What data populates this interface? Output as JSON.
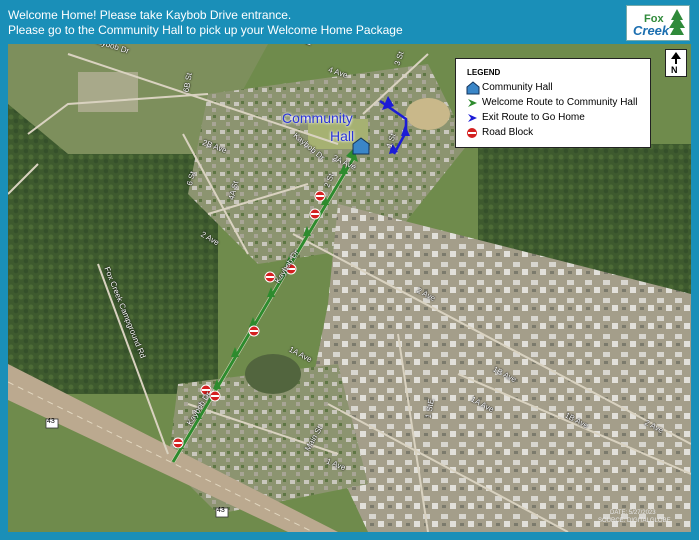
{
  "header": {
    "line1": "Welcome Home! Please take Kaybob Drive entrance.",
    "line2": "Please go to the Community Hall to pick up your Welcome Home Package"
  },
  "logo": {
    "line1": "Fox",
    "line2": "Creek"
  },
  "colors": {
    "frame": "#1a8fb8",
    "welcome_route": "#2e8b2e",
    "exit_route": "#1c1cd6",
    "road_block": "#d42020",
    "community_hall": "#3a86c8",
    "label_blue": "#2b35d8"
  },
  "legend": {
    "title": "LEGEND",
    "items": [
      {
        "icon": "community-hall-icon",
        "label": "Community Hall"
      },
      {
        "icon": "green-route-arrow-icon",
        "label": "Welcome Route to Community Hall"
      },
      {
        "icon": "blue-route-arrow-icon",
        "label": "Exit Route to Go Home"
      },
      {
        "icon": "road-block-icon",
        "label": "Road Block"
      }
    ]
  },
  "north_arrow": {
    "letter": "N"
  },
  "map_labels": {
    "community_hall_1": "Community",
    "community_hall_2": "Hall",
    "kaybob_dr_upper": "Kaybob Dr",
    "kaybob_dr_top": "Kaybob Dr",
    "kaybob_dr_mid": "Kaybob Dr",
    "kaybob_dr_low": "Kaybob Dr",
    "sixb_st": "6B St",
    "fourth_ave": "4 Ave",
    "third_st": "3 St",
    "second_b_ave": "2B Ave",
    "sixth_st": "6 St",
    "fourA_st": "4A St",
    "second_ave_w": "2 Ave",
    "second_a_ave": "2A Ave",
    "second_st": "2 St",
    "first_st": "1 St",
    "second_ave_e": "2 Ave",
    "campground_rd": "Fox Creek Campground Rd",
    "first_a_ave": "1A Ave",
    "first_b_ave": "1B Ave",
    "first_a_ave_e": "1A Ave",
    "first_b_ave_e": "1B Ave",
    "second_ave_far": "2 Ave",
    "first_ste": "1 StE",
    "main_st": "Main St",
    "first_ave": "1 Ave",
    "hwy_43_a": "43",
    "hwy_43_b": "43",
    "k_label": "K"
  },
  "credits": {
    "line1": "DATE: 5/27/2023",
    "line2": "SOURCE: DIGITALGLOBE"
  }
}
